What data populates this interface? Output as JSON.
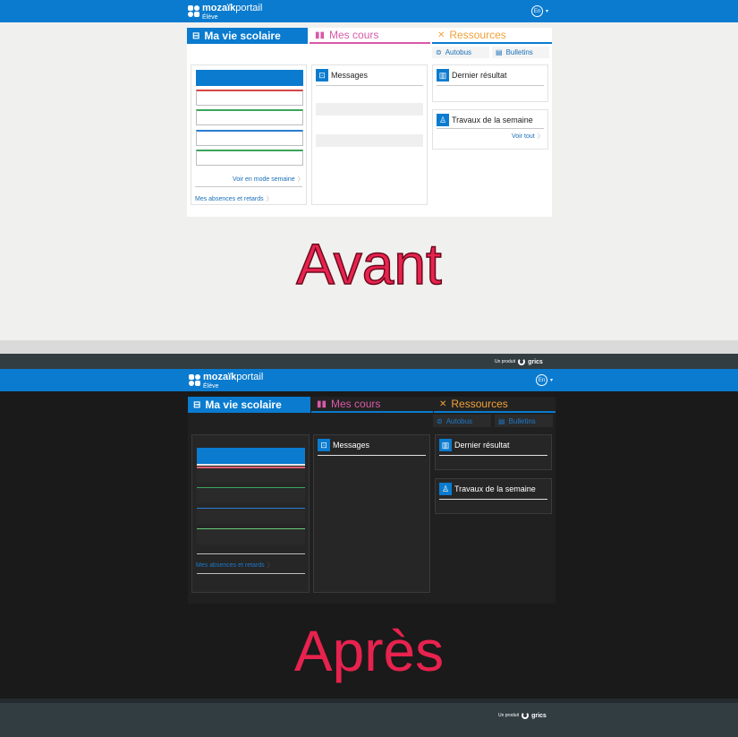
{
  "app": {
    "brand_bold": "mozaïk",
    "brand_light": "portail",
    "role": "Élève",
    "language": "En",
    "caret": "▾"
  },
  "tabs": {
    "vie_scolaire": "Ma vie scolaire",
    "mes_cours": "Mes cours",
    "ressources": "Ressources"
  },
  "subtabs": {
    "autobus": "Autobus",
    "bulletins": "Bulletins"
  },
  "widgets": {
    "messages": "Messages",
    "dernier_resultat": "Dernier résultat",
    "travaux": "Travaux de la semaine",
    "voir_tout": "Voir tout",
    "voir_semaine": "Voir en mode semaine",
    "absences": "Mes absences et retards"
  },
  "product": {
    "prefix": "Un produit",
    "name": "grics"
  },
  "captions": {
    "before": "Avant",
    "after": "Après"
  },
  "colors": {
    "accent_blue": "#0a7bcf",
    "courses_pink": "#d85aa8",
    "resources_orange": "#f1a23a",
    "caption_red": "#e8224e"
  }
}
